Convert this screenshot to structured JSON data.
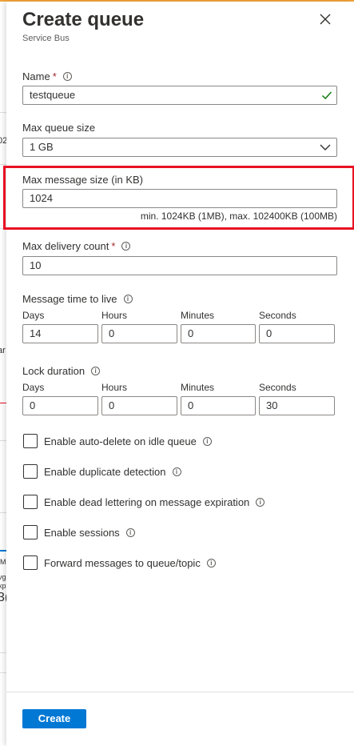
{
  "background": {
    "fragments": [
      "02",
      "ar",
      "M",
      "vg",
      "xp",
      "3("
    ]
  },
  "panel": {
    "title": "Create queue",
    "subtitle": "Service Bus"
  },
  "form": {
    "name": {
      "label": "Name",
      "required_mark": "*",
      "value": "testqueue"
    },
    "max_queue_size": {
      "label": "Max queue size",
      "selected": "1 GB"
    },
    "max_message_size": {
      "label": "Max message size (in KB)",
      "value": "1024",
      "hint": "min. 1024KB (1MB), max. 102400KB (100MB)"
    },
    "max_delivery_count": {
      "label": "Max delivery count",
      "required_mark": "*",
      "value": "10"
    },
    "message_ttl": {
      "label": "Message time to live",
      "days_label": "Days",
      "hours_label": "Hours",
      "minutes_label": "Minutes",
      "seconds_label": "Seconds",
      "days": "14",
      "hours": "0",
      "minutes": "0",
      "seconds": "0"
    },
    "lock_duration": {
      "label": "Lock duration",
      "days_label": "Days",
      "hours_label": "Hours",
      "minutes_label": "Minutes",
      "seconds_label": "Seconds",
      "days": "0",
      "hours": "0",
      "minutes": "0",
      "seconds": "30"
    },
    "checkboxes": {
      "auto_delete": "Enable auto-delete on idle queue",
      "duplicate_detection": "Enable duplicate detection",
      "dead_lettering": "Enable dead lettering on message expiration",
      "sessions": "Enable sessions",
      "forward": "Forward messages to queue/topic"
    },
    "info_glyph": "i"
  },
  "footer": {
    "create_label": "Create"
  },
  "colors": {
    "accent": "#0078d4",
    "highlight": "#e81123",
    "required": "#a4262c",
    "valid": "#107c10"
  }
}
